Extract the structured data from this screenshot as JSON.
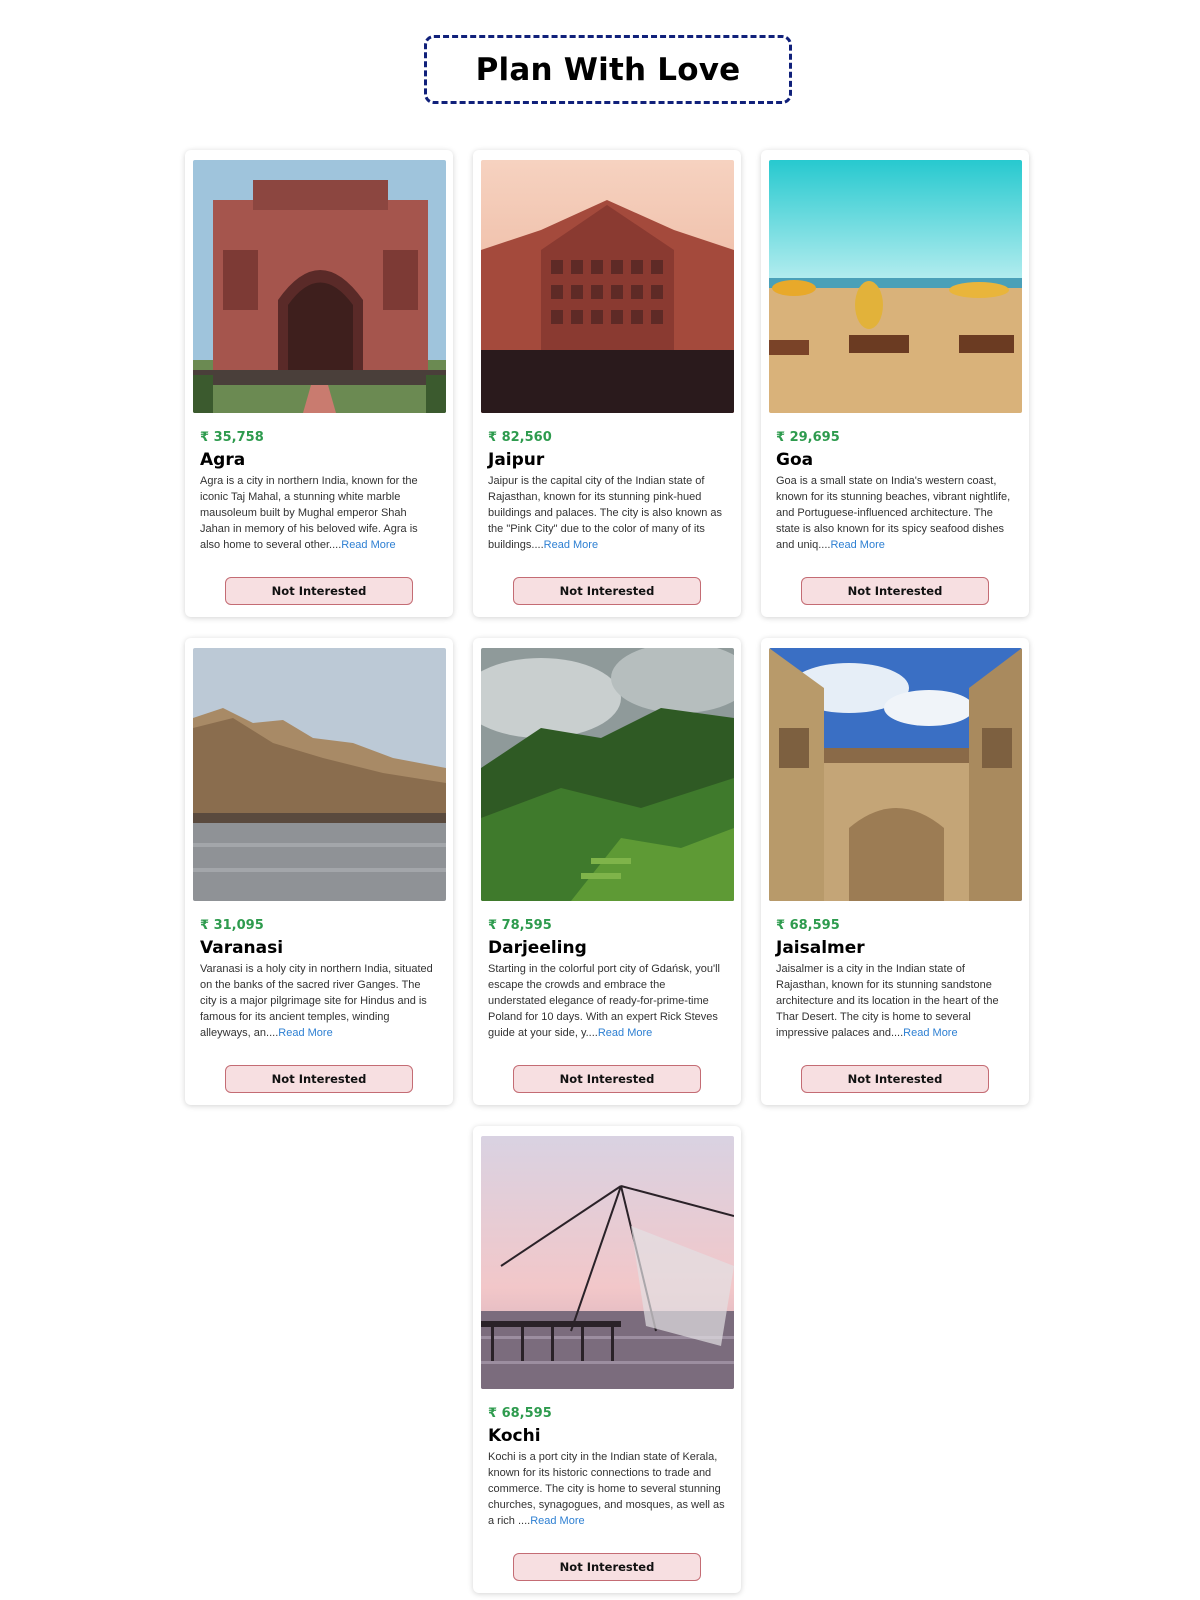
{
  "page": {
    "title": "Plan With Love"
  },
  "tours": [
    {
      "price": "₹ 35,758",
      "name": "Agra",
      "description": "Agra is a city in northern India, known for the iconic Taj Mahal, a stunning white marble mausoleum built by Mughal emperor Shah Jahan in memory of his beloved wife. Agra is also home to several other....",
      "read_more": "Read More",
      "button": "Not Interested",
      "image": "agra-gate-photo"
    },
    {
      "price": "₹ 82,560",
      "name": "Jaipur",
      "description": "Jaipur is the capital city of the Indian state of Rajasthan, known for its stunning pink-hued buildings and palaces. The city is also known as the \"Pink City\" due to the color of many of its buildings....",
      "read_more": "Read More",
      "button": "Not Interested",
      "image": "hawa-mahal-photo"
    },
    {
      "price": "₹ 29,695",
      "name": "Goa",
      "description": "Goa is a small state on India's western coast, known for its stunning beaches, vibrant nightlife, and Portuguese-influenced architecture. The state is also known for its spicy seafood dishes and uniq....",
      "read_more": "Read More",
      "button": "Not Interested",
      "image": "goa-beach-photo"
    },
    {
      "price": "₹ 31,095",
      "name": "Varanasi",
      "description": "Varanasi is a holy city in northern India, situated on the banks of the sacred river Ganges. The city is a major pilgrimage site for Hindus and is famous for its ancient temples, winding alleyways, an....",
      "read_more": "Read More",
      "button": "Not Interested",
      "image": "varanasi-ghats-photo"
    },
    {
      "price": "₹ 78,595",
      "name": "Darjeeling",
      "description": "Starting in the colorful port city of Gdańsk, you'll escape the crowds and embrace the understated elegance of ready-for-prime-time Poland for 10 days. With an expert Rick Steves guide at your side, y....",
      "read_more": "Read More",
      "button": "Not Interested",
      "image": "darjeeling-hills-photo"
    },
    {
      "price": "₹ 68,595",
      "name": "Jaisalmer",
      "description": "Jaisalmer is a city in the Indian state of Rajasthan, known for its stunning sandstone architecture and its location in the heart of the Thar Desert. The city is home to several impressive palaces and....",
      "read_more": "Read More",
      "button": "Not Interested",
      "image": "jaisalmer-haveli-photo"
    },
    {
      "price": "₹ 68,595",
      "name": "Kochi",
      "description": "Kochi is a port city in the Indian state of Kerala, known for its historic connections to trade and commerce. The city is home to several stunning churches, synagogues, and mosques, as well as a rich ....",
      "read_more": "Read More",
      "button": "Not Interested",
      "image": "kochi-fishing-net-photo"
    }
  ],
  "colors": {
    "price": "#2e9b4e",
    "read_more": "#2d7fd2",
    "button_bg": "#f7dfe1",
    "button_border": "#c46c74",
    "title_border": "#10207a"
  }
}
